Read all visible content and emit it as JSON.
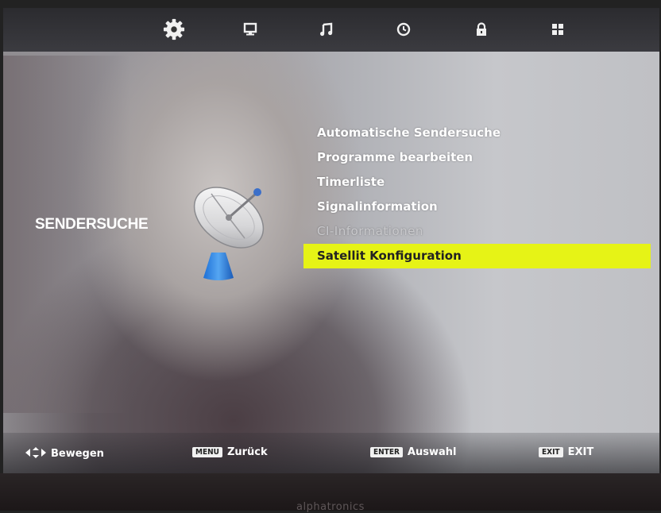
{
  "top_tabs": [
    {
      "name": "gear-icon",
      "active": true
    },
    {
      "name": "monitor-icon",
      "active": false
    },
    {
      "name": "music-note-icon",
      "active": false
    },
    {
      "name": "clock-icon",
      "active": false
    },
    {
      "name": "lock-icon",
      "active": false
    },
    {
      "name": "grid-icon",
      "active": false
    }
  ],
  "category_title": "SENDERSUCHE",
  "category_icon": "satellite-dish-icon",
  "menu": {
    "items": [
      {
        "label": "Automatische Sendersuche",
        "state": "normal"
      },
      {
        "label": "Programme bearbeiten",
        "state": "normal"
      },
      {
        "label": "Timerliste",
        "state": "normal"
      },
      {
        "label": "Signalinformation",
        "state": "normal"
      },
      {
        "label": "CI-Informationen",
        "state": "disabled"
      },
      {
        "label": "Satellit Konfiguration",
        "state": "selected"
      }
    ],
    "selected_color": "#e6f316"
  },
  "hints": {
    "move": {
      "icon": "directional-arrows-icon",
      "label": "Bewegen"
    },
    "back": {
      "key": "MENU",
      "label": "Zurück"
    },
    "select": {
      "key": "ENTER",
      "label": "Auswahl"
    },
    "exit": {
      "key": "EXIT",
      "label": "EXIT"
    }
  },
  "brand": "alphatronics"
}
